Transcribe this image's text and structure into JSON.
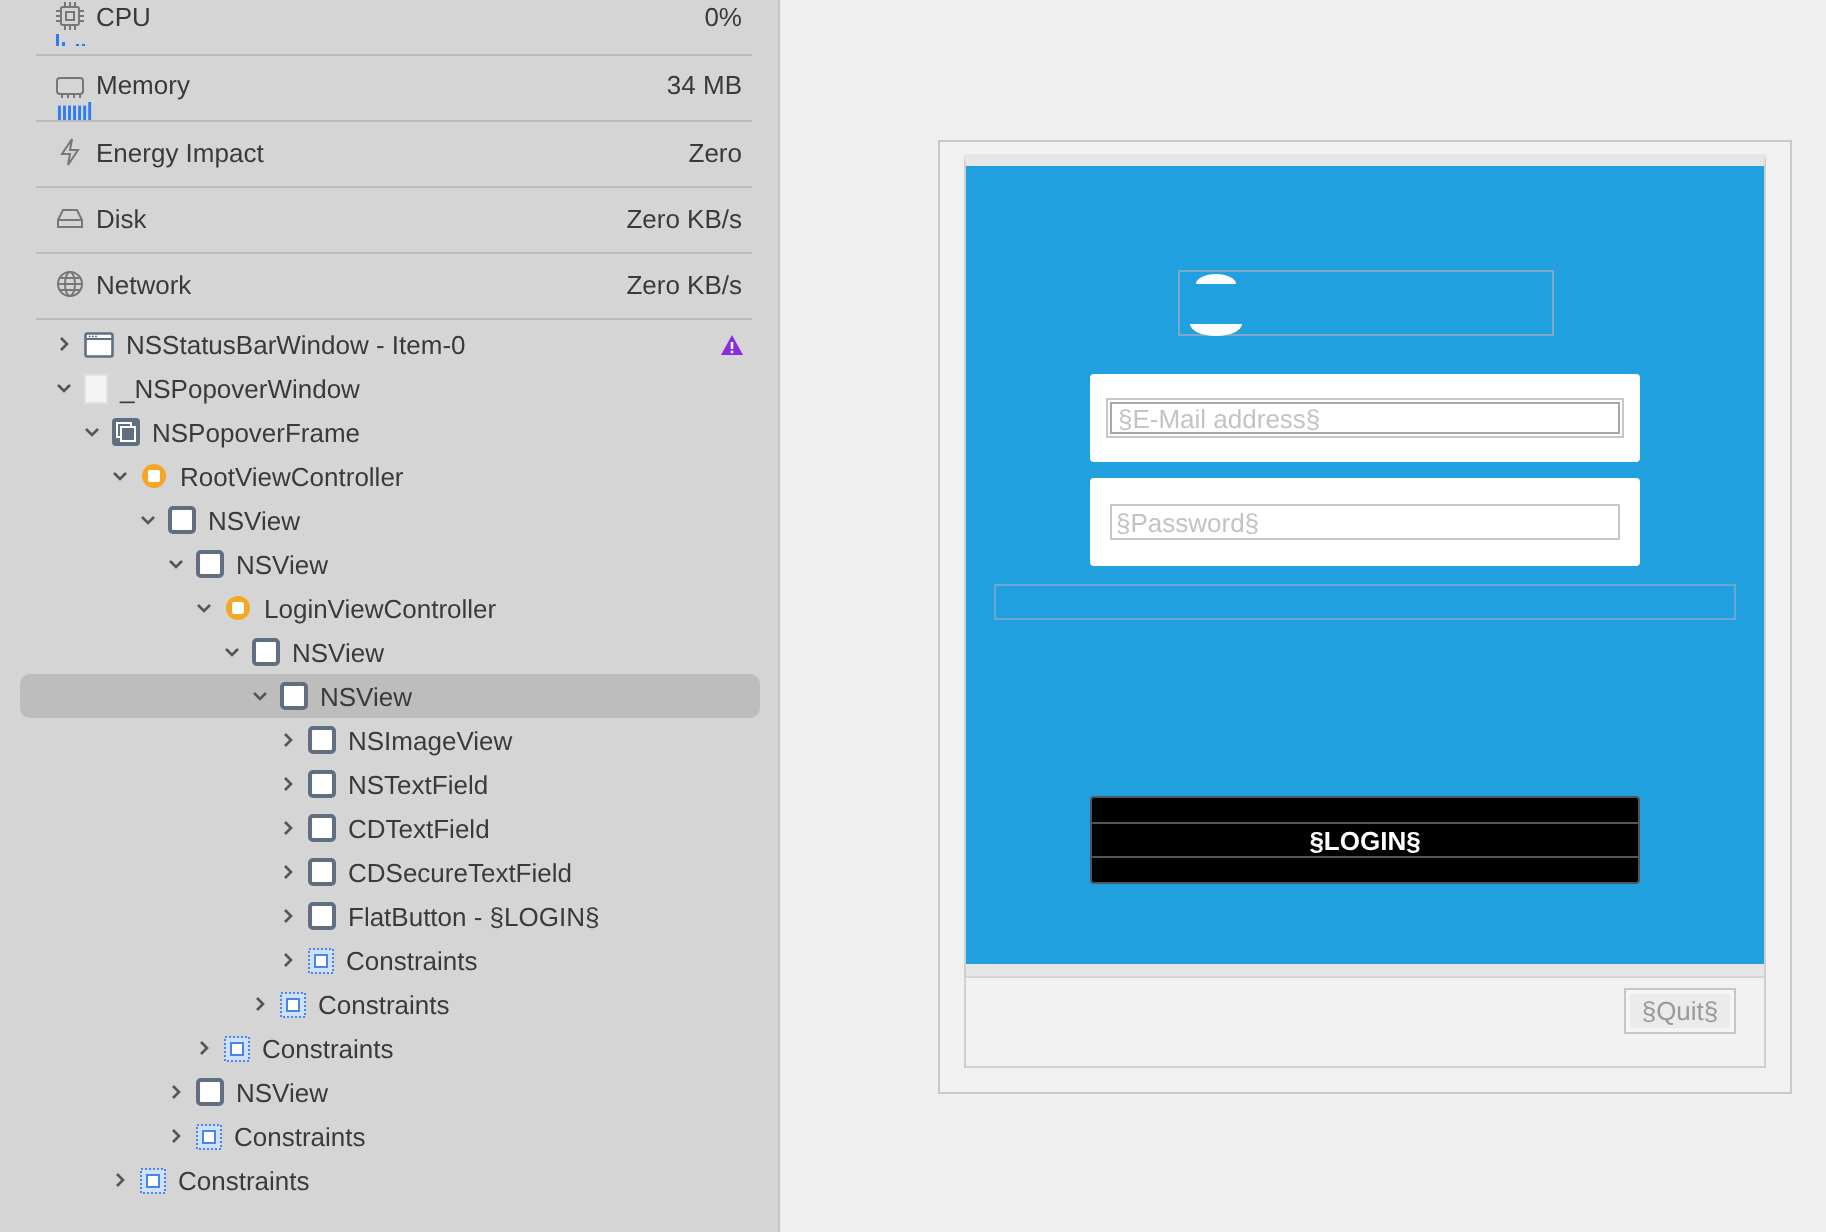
{
  "inspector": {
    "gauges": [
      {
        "kind": "cpu",
        "label": "CPU",
        "value": "0%"
      },
      {
        "kind": "memory",
        "label": "Memory",
        "value": "34 MB"
      },
      {
        "kind": "energy",
        "label": "Energy Impact",
        "value": "Zero"
      },
      {
        "kind": "disk",
        "label": "Disk",
        "value": "Zero KB/s"
      },
      {
        "kind": "network",
        "label": "Network",
        "value": "Zero KB/s"
      }
    ],
    "tree": [
      {
        "label": "NSStatusBarWindow - Item-0",
        "kind": "window",
        "expanded": false,
        "selected": false,
        "warning": true
      },
      {
        "label": "_NSPopoverWindow",
        "kind": "document",
        "expanded": true,
        "selected": false,
        "warning": false,
        "children": [
          {
            "label": "NSPopoverFrame",
            "kind": "frame",
            "expanded": true,
            "selected": false,
            "warning": false,
            "children": [
              {
                "label": "RootViewController",
                "kind": "controller",
                "expanded": true,
                "selected": false,
                "warning": false,
                "children": [
                  {
                    "label": "NSView",
                    "kind": "view",
                    "expanded": true,
                    "selected": false,
                    "warning": false,
                    "children": [
                      {
                        "label": "NSView",
                        "kind": "view",
                        "expanded": true,
                        "selected": false,
                        "warning": false,
                        "children": [
                          {
                            "label": "LoginViewController",
                            "kind": "controller",
                            "expanded": true,
                            "selected": false,
                            "warning": false,
                            "children": [
                              {
                                "label": "NSView",
                                "kind": "view",
                                "expanded": true,
                                "selected": false,
                                "warning": false,
                                "children": [
                                  {
                                    "label": "NSView",
                                    "kind": "view",
                                    "expanded": true,
                                    "selected": true,
                                    "warning": false,
                                    "children": [
                                      {
                                        "label": "NSImageView",
                                        "kind": "view",
                                        "expanded": false,
                                        "selected": false,
                                        "warning": false
                                      },
                                      {
                                        "label": "NSTextField",
                                        "kind": "view",
                                        "expanded": false,
                                        "selected": false,
                                        "warning": false
                                      },
                                      {
                                        "label": "CDTextField",
                                        "kind": "view",
                                        "expanded": false,
                                        "selected": false,
                                        "warning": false
                                      },
                                      {
                                        "label": "CDSecureTextField",
                                        "kind": "view",
                                        "expanded": false,
                                        "selected": false,
                                        "warning": false
                                      },
                                      {
                                        "label": "FlatButton - §LOGIN§",
                                        "kind": "view",
                                        "expanded": false,
                                        "selected": false,
                                        "warning": false
                                      },
                                      {
                                        "label": "Constraints",
                                        "kind": "constraints",
                                        "expanded": false,
                                        "selected": false,
                                        "warning": false
                                      }
                                    ]
                                  },
                                  {
                                    "label": "Constraints",
                                    "kind": "constraints",
                                    "expanded": false,
                                    "selected": false,
                                    "warning": false
                                  }
                                ]
                              }
                            ]
                          },
                          {
                            "label": "Constraints",
                            "kind": "constraints",
                            "expanded": false,
                            "selected": false,
                            "warning": false
                          }
                        ]
                      },
                      {
                        "label": "NSView",
                        "kind": "view",
                        "expanded": false,
                        "selected": false,
                        "warning": false
                      },
                      {
                        "label": "Constraints",
                        "kind": "constraints",
                        "expanded": false,
                        "selected": false,
                        "warning": false
                      }
                    ]
                  }
                ]
              },
              {
                "label": "Constraints",
                "kind": "constraints",
                "expanded": false,
                "selected": false,
                "warning": false
              }
            ]
          }
        ]
      }
    ]
  },
  "preview": {
    "email_field": {
      "placeholder": "§E-Mail address§"
    },
    "password_field": {
      "placeholder": "§Password§"
    },
    "login_button": "§LOGIN§",
    "quit_button": "§Quit§"
  }
}
